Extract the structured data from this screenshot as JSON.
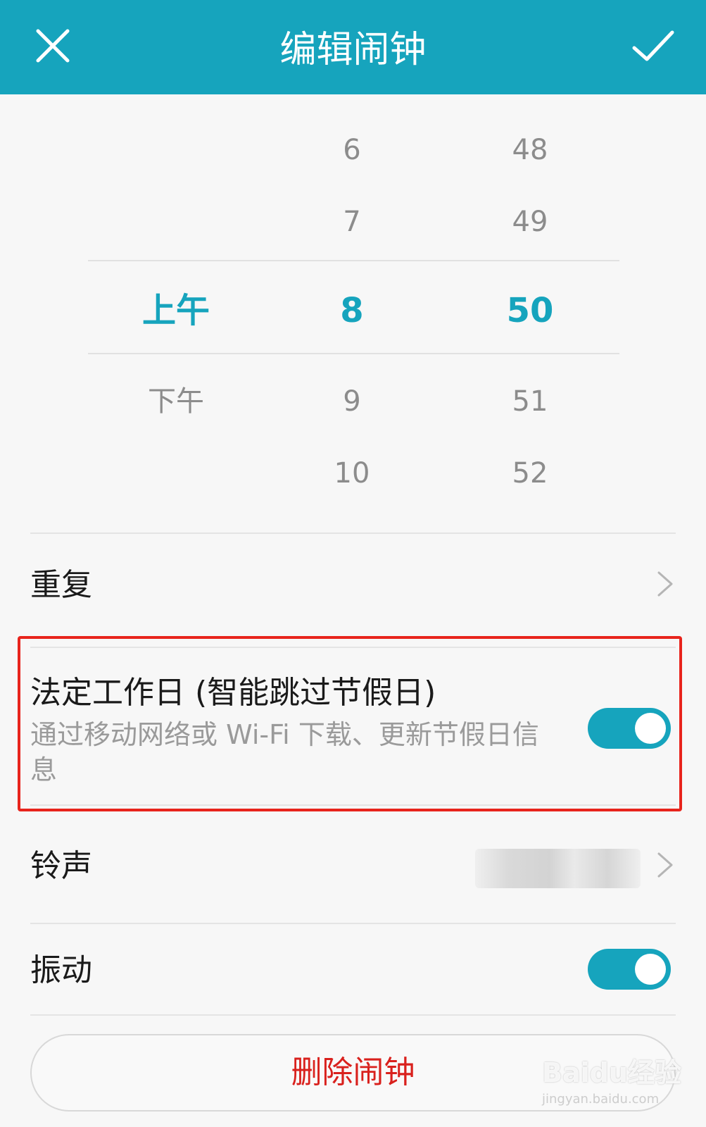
{
  "header": {
    "title": "编辑闹钟",
    "close_icon": "close-icon",
    "confirm_icon": "check-icon",
    "background": "#16a4bd"
  },
  "picker": {
    "ampm": [
      "",
      "",
      "上午",
      "下午",
      ""
    ],
    "hours": [
      "6",
      "7",
      "8",
      "9",
      "10"
    ],
    "minutes": [
      "48",
      "49",
      "50",
      "51",
      "52"
    ],
    "selected_index": 2,
    "accent": "#16a4bd"
  },
  "repeat": {
    "label": "重复",
    "chevron_icon": "chevron-right-icon"
  },
  "workday": {
    "label": "法定工作日 (智能跳过节假日)",
    "description": "通过移动网络或 Wi-Fi 下载、更新节假日信息",
    "enabled": true,
    "highlight_color": "#e8241c"
  },
  "ringtone": {
    "label": "铃声",
    "chevron_icon": "chevron-right-icon"
  },
  "vibrate": {
    "label": "振动",
    "enabled": true
  },
  "delete": {
    "label": "删除闹钟",
    "color": "#d9211d"
  },
  "watermark": {
    "text": "Baidu经验",
    "sub": "jingyan.baidu.com"
  }
}
